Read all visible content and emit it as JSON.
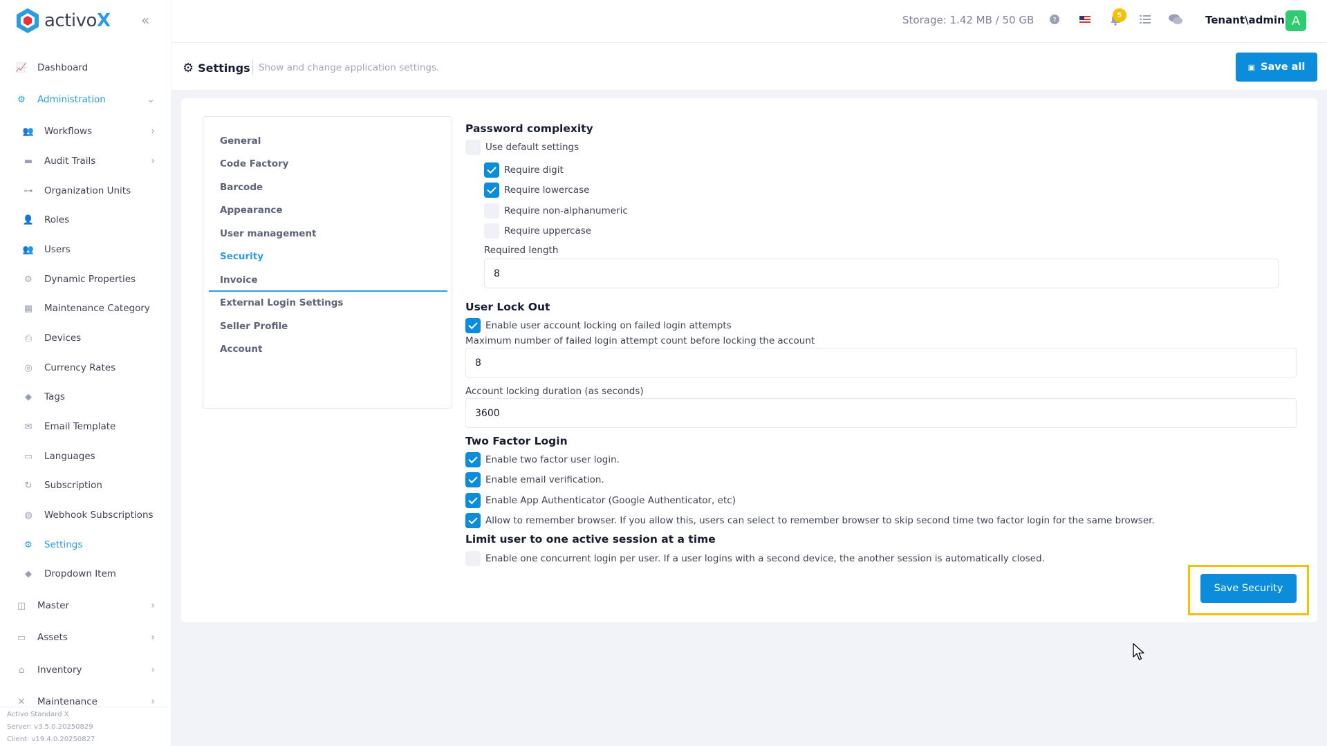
{
  "app": {
    "logo_text": "activo",
    "logo_x": "X"
  },
  "sidebar": {
    "items": [
      {
        "label": "Dashboard",
        "icon": "chart-line-icon"
      },
      {
        "label": "Administration",
        "icon": "cogs-icon",
        "expanded": true
      },
      {
        "label": "Workflows",
        "icon": "users-icon"
      },
      {
        "label": "Audit Trails",
        "icon": "folder-icon"
      },
      {
        "label": "Organization Units",
        "icon": "sitemap-icon"
      },
      {
        "label": "Roles",
        "icon": "user-tag-icon"
      },
      {
        "label": "Users",
        "icon": "users-icon"
      },
      {
        "label": "Dynamic Properties",
        "icon": "gear-icon"
      },
      {
        "label": "Maintenance Category",
        "icon": "grid-icon"
      },
      {
        "label": "Devices",
        "icon": "printer-icon"
      },
      {
        "label": "Currency Rates",
        "icon": "coins-icon"
      },
      {
        "label": "Tags",
        "icon": "tags-icon"
      },
      {
        "label": "Email Template",
        "icon": "envelope-icon"
      },
      {
        "label": "Languages",
        "icon": "language-icon"
      },
      {
        "label": "Subscription",
        "icon": "refresh-icon"
      },
      {
        "label": "Webhook Subscriptions",
        "icon": "globe-icon"
      },
      {
        "label": "Settings",
        "icon": "gear-icon",
        "active": true
      },
      {
        "label": "Dropdown Item",
        "icon": "tags-icon"
      },
      {
        "label": "Master",
        "icon": "database-icon"
      },
      {
        "label": "Assets",
        "icon": "laptop-icon"
      },
      {
        "label": "Inventory",
        "icon": "warehouse-icon"
      },
      {
        "label": "Maintenance",
        "icon": "tools-icon"
      }
    ],
    "footer": {
      "product": "Activo Standard X",
      "server": "Server: v3.5.0.20250829",
      "client": "Client: v19.4.0.20250827"
    }
  },
  "topbar": {
    "storage": "Storage: 1.42 MB / 50 GB",
    "notification_count": "5",
    "user": "Tenant\\admin",
    "avatar_letter": "A"
  },
  "subheader": {
    "title": "Settings",
    "description": "Show and change application settings.",
    "save_all": "Save all"
  },
  "tabs": [
    "General",
    "Code Factory",
    "Barcode",
    "Appearance",
    "User management",
    "Security",
    "Invoice",
    "External Login Settings",
    "Seller Profile",
    "Account"
  ],
  "active_tab": "Security",
  "security": {
    "password_complexity": {
      "heading": "Password complexity",
      "use_default": {
        "label": "Use default settings",
        "checked": false
      },
      "require_digit": {
        "label": "Require digit",
        "checked": true
      },
      "require_lowercase": {
        "label": "Require lowercase",
        "checked": true
      },
      "require_nonalnum": {
        "label": "Require non-alphanumeric",
        "checked": false
      },
      "require_uppercase": {
        "label": "Require uppercase",
        "checked": false
      },
      "required_length_label": "Required length",
      "required_length": "8"
    },
    "lockout": {
      "heading": "User Lock Out",
      "enable": {
        "label": "Enable user account locking on failed login attempts",
        "checked": true
      },
      "max_attempts_label": "Maximum number of failed login attempt count before locking the account",
      "max_attempts": "8",
      "duration_label": "Account locking duration (as seconds)",
      "duration": "3600"
    },
    "two_factor": {
      "heading": "Two Factor Login",
      "enable": {
        "label": "Enable two factor user login.",
        "checked": true
      },
      "email": {
        "label": "Enable email verification.",
        "checked": true
      },
      "app": {
        "label": "Enable App Authenticator (Google Authenticator, etc)",
        "checked": true
      },
      "remember": {
        "label": "Allow to remember browser. If you allow this, users can select to remember browser to skip second time two factor login for the same browser.",
        "checked": true
      }
    },
    "session": {
      "heading": "Limit user to one active session at a time",
      "enable": {
        "label": "Enable one concurrent login per user. If a user logins with a second device, the another session is automatically closed.",
        "checked": false
      }
    },
    "save_button": "Save Security"
  }
}
